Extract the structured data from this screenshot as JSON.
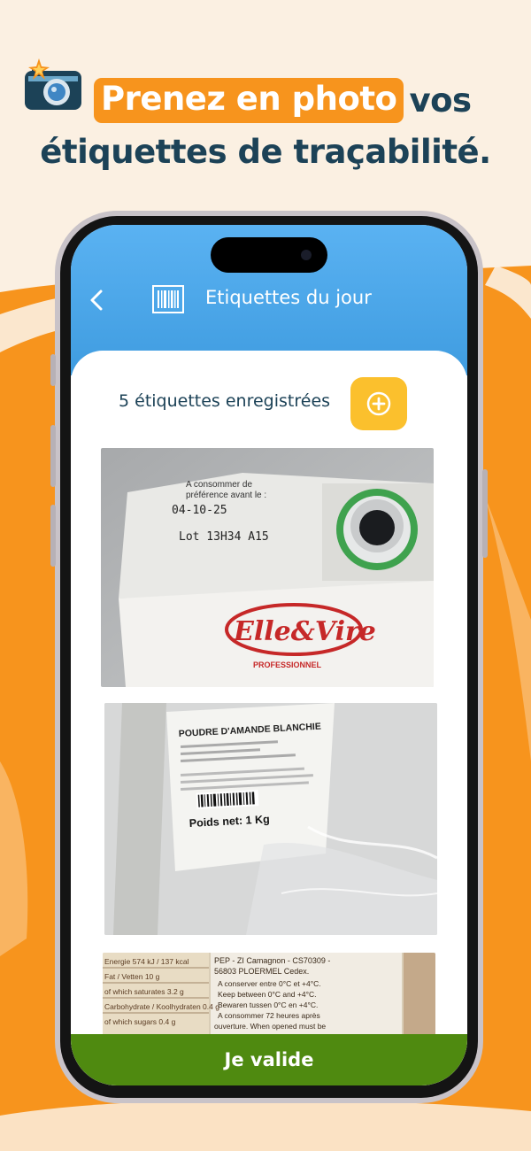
{
  "headline": {
    "highlight": "Prenez en photo",
    "line1_rest": "vos",
    "line2": "étiquettes de traçabilité."
  },
  "icons": {
    "camera": "camera-sparkle-icon",
    "back": "chevron-left-icon",
    "barcode": "barcode-icon",
    "add": "plus-circle-icon"
  },
  "colors": {
    "orange": "#f7941d",
    "navy": "#1c4257",
    "header_blue": "#4aa7eb",
    "add_yellow": "#fbc02d",
    "validate_green": "#4f8a10"
  },
  "header": {
    "title": "Etiquettes du jour"
  },
  "count_label": "5 étiquettes enregistrées",
  "photos": [
    {
      "label_text": {
        "line1": "A consommer de",
        "line2": "préférence avant le :",
        "date": "04-10-25",
        "lot": "Lot 13H34  A15",
        "brand": "Elle&Vire",
        "brand_sub": "PROFESSIONNEL"
      }
    },
    {
      "label_text": {
        "product": "POUDRE D'AMANDE BLANCHIE",
        "weight": "Poids net: 1 Kg"
      }
    },
    {
      "label_text": {
        "nutri1": "Energie   574 kJ / 137 kcal",
        "nutri2": "Fat / Vetten   10 g",
        "nutri3": "of which saturates   3.2 g",
        "nutri4": "Carbohydrate / Koolhydraten   0.4 g",
        "nutri5": "of which sugars   0.4 g",
        "addr1": "PEP - ZI Camagnon - CS70309 -",
        "addr2": "56803 PLOERMEL Cedex.",
        "c1": "A conserver entre 0°C et +4°C.",
        "c2": "Keep between 0°C and +4°C.",
        "c3": "Bewaren tussen 0°C en +4°C.",
        "c4": "A consommer 72 heures après",
        "c5": "ouverture.   When opened must be"
      }
    }
  ],
  "validate_label": "Je valide"
}
